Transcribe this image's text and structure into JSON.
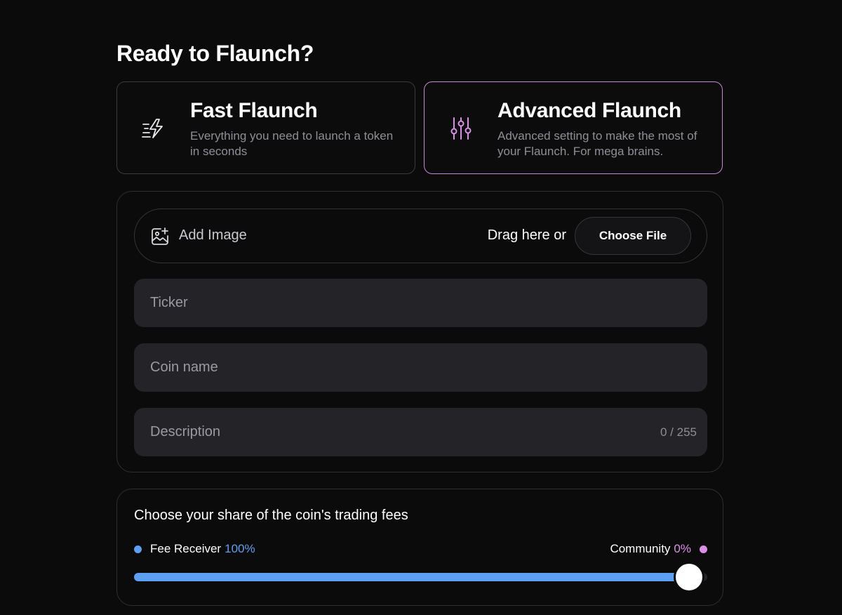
{
  "page": {
    "title": "Ready to Flaunch?"
  },
  "modes": {
    "fast": {
      "title": "Fast Flaunch",
      "description": "Everything you need to launch a token in seconds",
      "icon": "lightning-icon"
    },
    "advanced": {
      "title": "Advanced Flaunch",
      "description": "Advanced setting to make the most of your Flaunch. For mega brains.",
      "icon": "sliders-icon",
      "selected": true
    }
  },
  "image_upload": {
    "label": "Add Image",
    "drag_text": "Drag here or",
    "button_label": "Choose File"
  },
  "fields": {
    "ticker": {
      "placeholder": "Ticker",
      "value": ""
    },
    "coin_name": {
      "placeholder": "Coin name",
      "value": ""
    },
    "description": {
      "placeholder": "Description",
      "value": "",
      "counter": "0 / 255"
    }
  },
  "fees": {
    "title": "Choose your share of the coin's trading fees",
    "receiver_label": "Fee Receiver",
    "receiver_pct": "100%",
    "community_label": "Community",
    "community_pct": "0%",
    "receiver_share": 1.0
  },
  "colors": {
    "accent_blue": "#5d9ff2",
    "accent_pink": "#dc8ee8",
    "selected_border": "#c68ad6",
    "background": "#0c0b0c"
  }
}
